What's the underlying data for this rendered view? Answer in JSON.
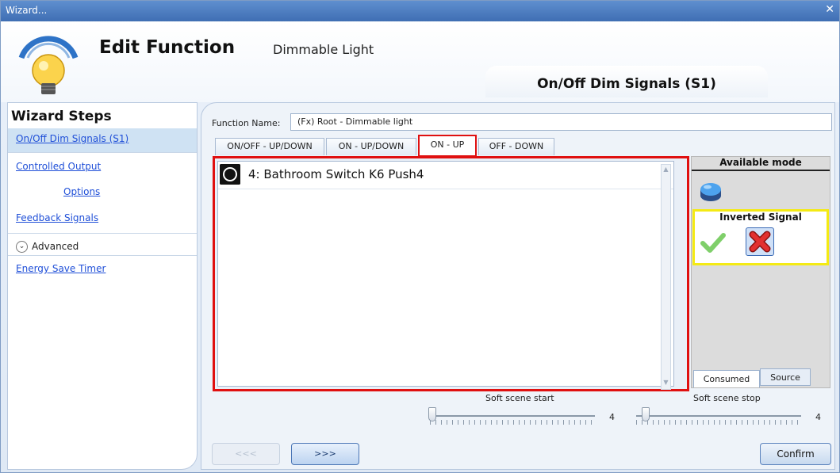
{
  "window": {
    "title": "Wizard...",
    "close_glyph": "✕"
  },
  "header": {
    "title": "Edit Function",
    "subtitle": "Dimmable Light",
    "current_step": "On/Off Dim Signals (S1)"
  },
  "sidebar": {
    "title": "Wizard Steps",
    "items": [
      {
        "label": "On/Off Dim Signals (S1)"
      },
      {
        "label": "Controlled Output"
      },
      {
        "label": "Options"
      },
      {
        "label": "Feedback Signals"
      },
      {
        "label": "Advanced"
      },
      {
        "label": "Energy Save Timer"
      }
    ]
  },
  "form": {
    "function_name_label": "Function Name:",
    "function_name_value": "(Fx) Root - Dimmable light"
  },
  "tabs": [
    {
      "label": "ON/OFF - UP/DOWN"
    },
    {
      "label": "ON - UP/DOWN"
    },
    {
      "label": "ON - UP"
    },
    {
      "label": "OFF - DOWN"
    }
  ],
  "signals": [
    {
      "label": "4: Bathroom Switch K6 Push4"
    }
  ],
  "mode_panel": {
    "available_mode_label": "Available mode",
    "inverted_signal_label": "Inverted Signal",
    "tabs": [
      {
        "label": "Consumed"
      },
      {
        "label": "Source"
      }
    ]
  },
  "sliders": [
    {
      "label": "Soft scene start",
      "value": "4"
    },
    {
      "label": "Soft scene stop",
      "value": "4"
    }
  ],
  "buttons": {
    "back": "<<<",
    "next": ">>>",
    "confirm": "Confirm"
  },
  "colors": {
    "highlight_red": "#e01010",
    "highlight_yellow": "#f4ea14",
    "link_blue": "#1f4fd8",
    "title_bar": "#4b7cc0"
  },
  "icons": [
    "bulb-icon",
    "signal-device-icon",
    "blue-push-button-icon",
    "check-icon",
    "x-icon",
    "chevron-down-icon",
    "close-icon"
  ]
}
